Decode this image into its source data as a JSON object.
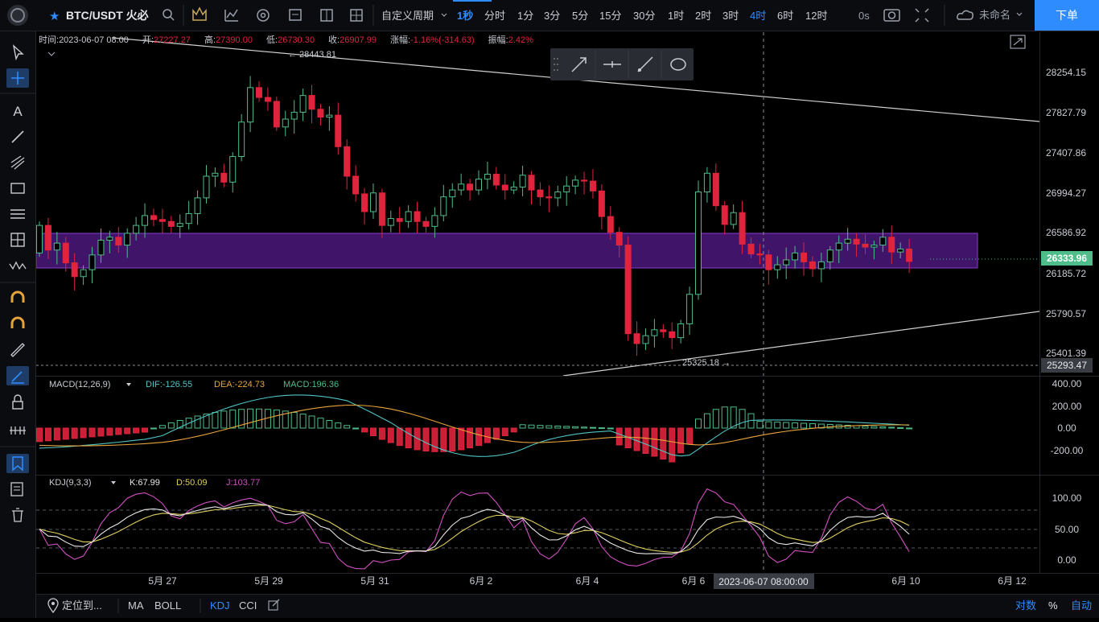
{
  "topbar": {
    "symbol": "BTC/USDT 火必",
    "custom_period_label": "自定义周期",
    "intervals": [
      "1秒",
      "分时",
      "1分",
      "3分",
      "5分",
      "15分",
      "30分",
      "1时",
      "2时",
      "3时",
      "4时",
      "6时",
      "12时"
    ],
    "active_interval": "4时",
    "seconds_label": "0s",
    "layout_name": "未命名",
    "order_button": "下单"
  },
  "legend": {
    "time_label": "时间:",
    "time": "2023-06-07 08:00",
    "open_label": "开:",
    "open": "27227.27",
    "high_label": "高:",
    "high": "27390.00",
    "low_label": "低:",
    "low": "26730.30",
    "close_label": "收:",
    "close": "26907.99",
    "change_label": "涨幅:",
    "change": "-1.16%(-314.63)",
    "amplitude_label": "振幅:",
    "amplitude": "2.42%"
  },
  "price_axis": {
    "ticks": [
      "28254.15",
      "27827.79",
      "27407.86",
      "26994.27",
      "26586.92",
      "26185.72",
      "25790.57",
      "25401.39"
    ],
    "current_price": "26333.96",
    "crosshair_price": "25293.47"
  },
  "annotations": {
    "high_marker": "← 28443.81",
    "low_marker": "25325.18 →"
  },
  "macd": {
    "title": "MACD(12,26,9)",
    "dif": "DIF:-126.55",
    "dea": "DEA:-224.73",
    "macd": "MACD:196.36",
    "ticks": [
      "400.00",
      "200.00",
      "0.00",
      "-200.00"
    ]
  },
  "kdj": {
    "title": "KDJ(9,3,3)",
    "k": "K:67.99",
    "d": "D:50.09",
    "j": "J:103.77",
    "ticks": [
      "100.00",
      "50.00",
      "0.00"
    ]
  },
  "time_axis": {
    "labels": [
      "5月 27",
      "5月 29",
      "5月 31",
      "6月 2",
      "6月 4",
      "6月 6",
      "6月 10",
      "6月 12"
    ],
    "crosshair_time": "2023-06-07 08:00:00"
  },
  "bottombar": {
    "locate": "定位到...",
    "indicators": [
      "MA",
      "BOLL",
      "KDJ",
      "CCI"
    ],
    "active_indicator": "KDJ",
    "log_label": "对数",
    "percent_label": "%",
    "auto_label": "自动"
  },
  "colors": {
    "up": "#4fbd8a",
    "down": "#e0243d",
    "accent": "#2f8cff",
    "box": "#6a1fa0",
    "dif": "#4fc4c4",
    "dea": "#e8a43c",
    "k": "#e8e8e8",
    "d": "#e0d060",
    "j": "#d050c0"
  },
  "icons": {
    "left_tools": [
      "cursor-icon",
      "crosshair-icon",
      "text-icon",
      "trend-line-icon",
      "fib-icon",
      "rectangle-icon",
      "parallel-lines-icon",
      "measure-grid-icon",
      "wave-icon",
      "magnet-icon",
      "magnet-alt-icon",
      "ruler-icon",
      "pen-icon",
      "lock-icon",
      "visibility-icon",
      "bookmark-icon",
      "watchlist-icon",
      "trash-icon"
    ],
    "float_tools": [
      "arrow-line-icon",
      "horizontal-line-icon",
      "ray-icon",
      "ellipse-icon"
    ]
  }
}
